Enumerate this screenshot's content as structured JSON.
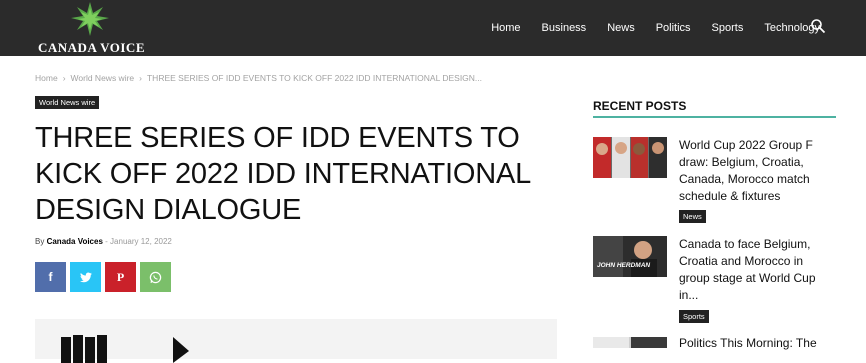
{
  "site": {
    "name": "Canada Voice"
  },
  "nav": {
    "items": [
      "Home",
      "Business",
      "News",
      "Politics",
      "Sports",
      "Technology"
    ]
  },
  "breadcrumb": [
    "Home",
    "World News wire",
    "THREE SERIES OF IDD EVENTS TO KICK OFF 2022 IDD INTERNATIONAL DESIGN..."
  ],
  "article": {
    "category": "World News wire",
    "title": "THREE SERIES OF IDD EVENTS TO KICK OFF 2022 IDD INTERNATIONAL DESIGN DIALOGUE",
    "by": "By",
    "author": "Canada Voices",
    "separator": "-",
    "date": "January 12, 2022"
  },
  "share": {
    "facebook": "f",
    "pinterest": "P"
  },
  "sidebar": {
    "heading": "RECENT POSTS",
    "posts": [
      {
        "title": "World Cup 2022 Group F draw: Belgium, Croatia, Canada, Morocco match schedule & fixtures",
        "tag": "News"
      },
      {
        "title": "Canada to face Belgium, Croatia and Morocco in group stage at World Cup in...",
        "tag": "Sports",
        "thumb_caption": "JOHN HERDMAN"
      },
      {
        "title": "Politics This Morning: The"
      }
    ]
  },
  "colors": {
    "topbar": "#2b2b2b",
    "accent": "#4db2a1",
    "facebook": "#516eab",
    "twitter": "#29c5f6",
    "pinterest": "#ca212a",
    "whatsapp": "#7bbf6a"
  }
}
